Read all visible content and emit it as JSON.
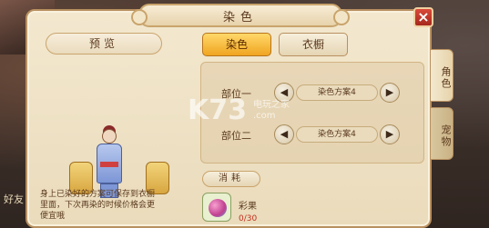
{
  "window": {
    "title": "染色",
    "close_icon": "close-icon"
  },
  "preview": {
    "title": "预览",
    "description": "身上已染好的方案可保存到衣橱里面，下次再染的时候价格会更便宜哦"
  },
  "tabs": [
    {
      "label": "染色",
      "active": true
    },
    {
      "label": "衣橱",
      "active": false
    }
  ],
  "parts": [
    {
      "label": "部位一",
      "scheme": "染色方案4"
    },
    {
      "label": "部位二",
      "scheme": "染色方案4"
    }
  ],
  "cost": {
    "title": "消耗",
    "item_name": "彩果",
    "item_count": "0/30"
  },
  "side_tabs": [
    {
      "label": "角色",
      "active": true
    },
    {
      "label": "宠物",
      "active": false
    }
  ],
  "scene": {
    "bottom_left_text": "好友"
  },
  "watermark": {
    "logo": "K73",
    "line1": "电玩之家",
    "line2": ".com"
  },
  "colors": {
    "accent": "#f0a520",
    "close": "#c03020"
  }
}
